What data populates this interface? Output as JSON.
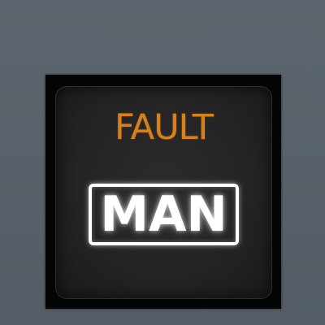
{
  "pushbutton": {
    "fault_label": "FAULT",
    "mode_label": "MAN"
  },
  "colors": {
    "fault_amber": "#d8801c",
    "mode_white": "#ffffff",
    "panel_gray": "#59626a",
    "bezel_black": "#050505"
  }
}
